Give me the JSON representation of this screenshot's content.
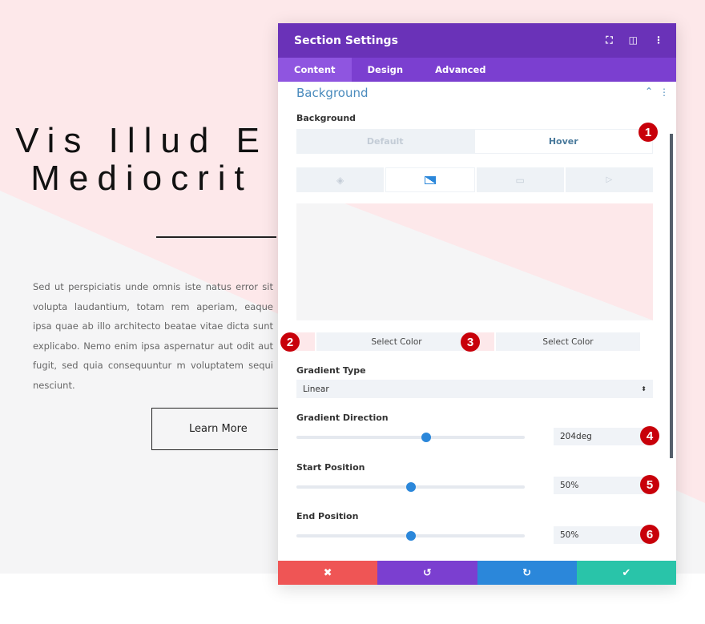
{
  "page": {
    "title": "Vis Illud E\nMediocrit",
    "body": "Sed ut perspiciatis unde omnis iste natus error sit volupta laudantium, totam rem aperiam, eaque ipsa quae ab illo architecto beatae vitae dicta sunt explicabo. Nemo enim ipsa aspernatur aut odit aut fugit, sed quia consequuntur m voluptatem sequi nesciunt.",
    "button": "Learn More"
  },
  "modal": {
    "title": "Section Settings",
    "tabs": [
      "Content",
      "Design",
      "Advanced"
    ],
    "section": "Background",
    "bg_label": "Background",
    "state_tabs": [
      "Default",
      "Hover"
    ],
    "bg_types": [
      "color-icon",
      "gradient-icon",
      "image-icon",
      "video-icon"
    ],
    "select_color_1": "Select Color",
    "select_color_2": "Select Color",
    "gradient_type_label": "Gradient Type",
    "gradient_type": "Linear",
    "direction_label": "Gradient Direction",
    "direction": "204deg",
    "direction_value": 204,
    "start_label": "Start Position",
    "start": "50%",
    "start_value": 50,
    "end_label": "End Position",
    "end": "50%",
    "end_value": 50,
    "badges": [
      "1",
      "2",
      "3",
      "4",
      "5",
      "6"
    ]
  },
  "colors": {
    "header": "#6a32b8",
    "cancel": "#ef5555",
    "undo": "#7b3fd0",
    "redo": "#2b87da",
    "save": "#29c4a9",
    "badge": "#c8000a"
  }
}
